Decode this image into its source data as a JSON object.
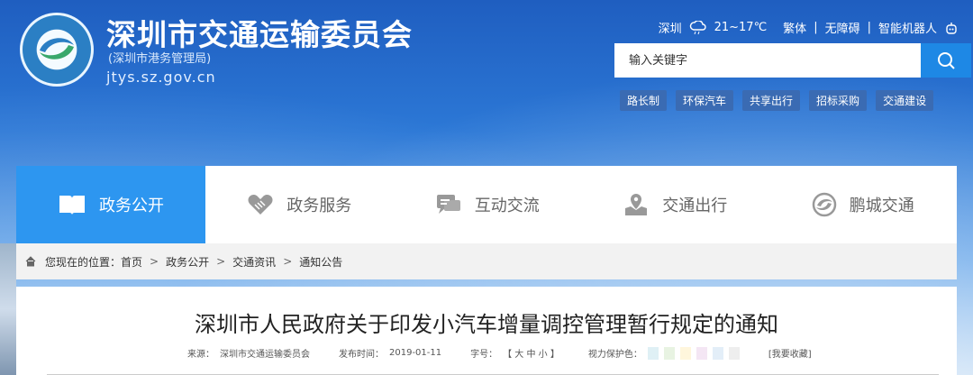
{
  "header": {
    "title": "深圳市交通运输委员会",
    "subtitle": "(深圳市港务管理局)",
    "domain": "jtys.sz.gov.cn"
  },
  "utility": {
    "city": "深圳",
    "weather": "21~17℃",
    "traditional": "繁体",
    "accessible": "无障碍",
    "robot": "智能机器人"
  },
  "search": {
    "placeholder": "输入关键字"
  },
  "quick_links": [
    "路长制",
    "环保汽车",
    "共享出行",
    "招标采购",
    "交通建设"
  ],
  "nav": [
    {
      "label": "政务公开",
      "icon": "book-icon",
      "active": true
    },
    {
      "label": "政务服务",
      "icon": "handshake-icon"
    },
    {
      "label": "互动交流",
      "icon": "chat-icon"
    },
    {
      "label": "交通出行",
      "icon": "map-pin-icon"
    },
    {
      "label": "鹏城交通",
      "icon": "swirl-icon"
    }
  ],
  "breadcrumb": {
    "prefix": "您现在的位置：",
    "items": [
      "首页",
      "政务公开",
      "交通资讯",
      "通知公告"
    ]
  },
  "article": {
    "title": "深圳市人民政府关于印发小汽车增量调控管理暂行规定的通知",
    "source_label": "来源：",
    "source": "深圳市交通运输委员会",
    "date_label": "发布时间：",
    "date": "2019-01-11",
    "font_label": "字号：",
    "font_sizes": "【 大 中 小 】",
    "eye_label": "视力保护色：",
    "eye_colors": [
      "#dff0f5",
      "#e8f3e2",
      "#fff6dc",
      "#f4e6f4",
      "#e3eef8",
      "#eeeeee"
    ],
    "favorite": "[我要收藏]"
  }
}
